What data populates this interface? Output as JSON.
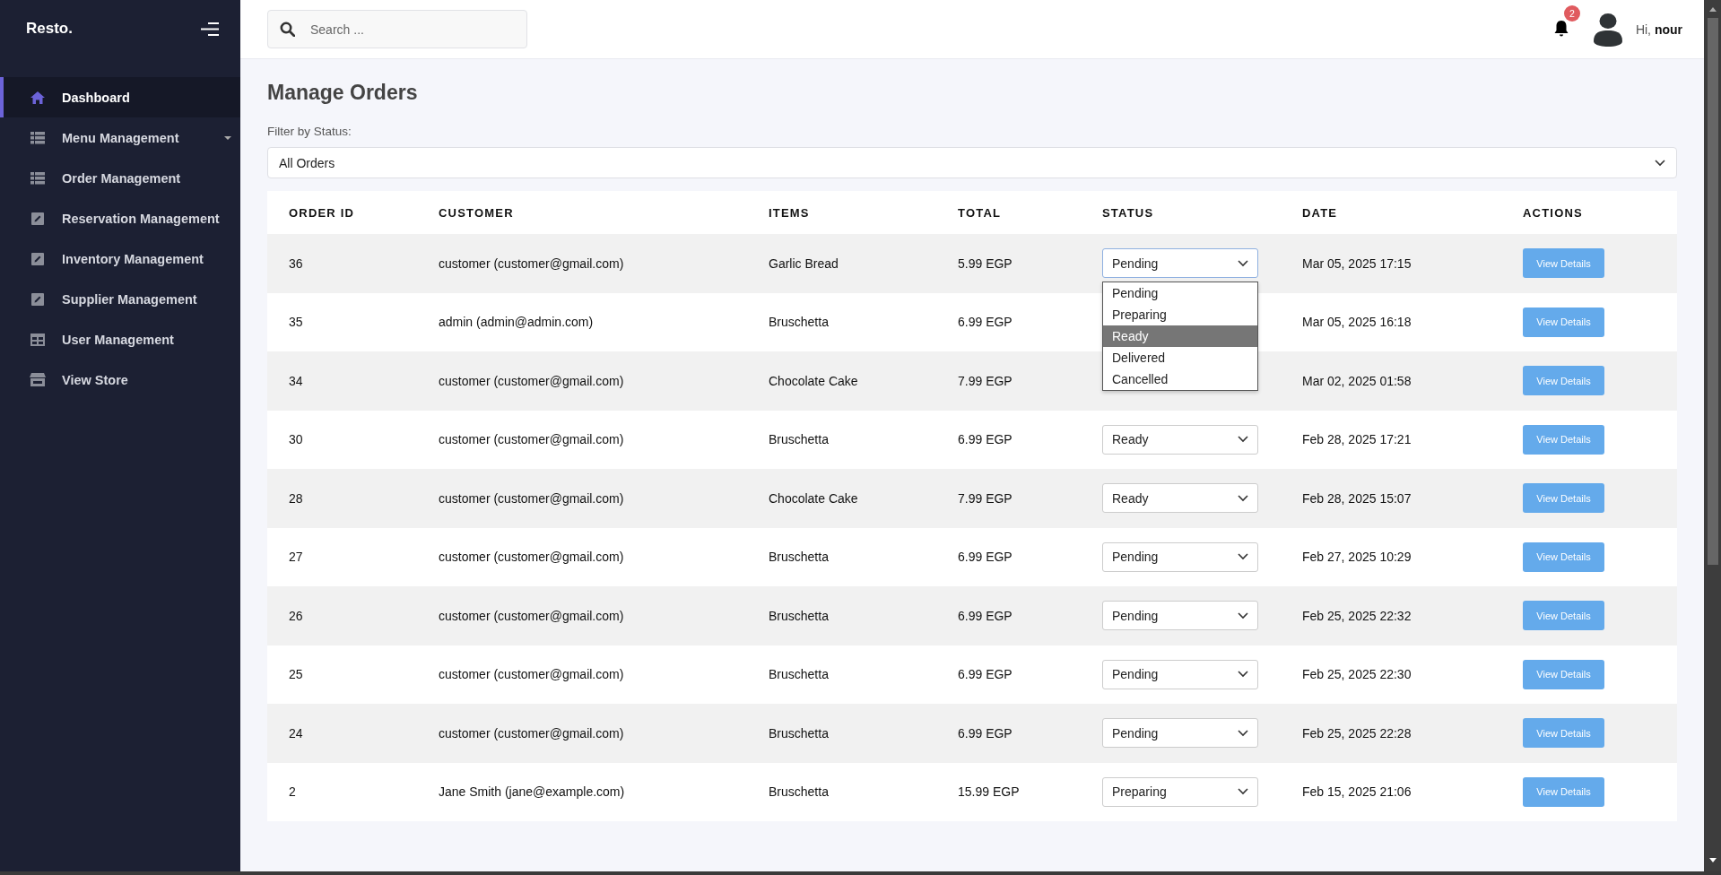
{
  "sidebar": {
    "logo": "Resto.",
    "items": [
      {
        "label": "Dashboard",
        "kind": "home",
        "selected": true,
        "expandable": false
      },
      {
        "label": "Menu Management",
        "kind": "list",
        "selected": false,
        "expandable": true
      },
      {
        "label": "Order Management",
        "kind": "list",
        "selected": false,
        "expandable": false
      },
      {
        "label": "Reservation Management",
        "kind": "edit",
        "selected": false,
        "expandable": false
      },
      {
        "label": "Inventory Management",
        "kind": "edit",
        "selected": false,
        "expandable": false
      },
      {
        "label": "Supplier Management",
        "kind": "edit",
        "selected": false,
        "expandable": false
      },
      {
        "label": "User Management",
        "kind": "grid",
        "selected": false,
        "expandable": false
      },
      {
        "label": "View Store",
        "kind": "store",
        "selected": false,
        "expandable": false
      }
    ]
  },
  "header": {
    "search": {
      "placeholder": "Search ..."
    },
    "notifications": {
      "count": "2"
    },
    "greeting": "Hi, **nour**"
  },
  "page": {
    "title": "Manage Orders",
    "filter": {
      "label": "Filter by Status:",
      "value": "All Orders"
    }
  },
  "table": {
    "columns": [
      "ORDER ID",
      "CUSTOMER",
      "ITEMS",
      "TOTAL",
      "STATUS",
      "DATE",
      "ACTIONS"
    ],
    "rows": [
      {
        "id": "36",
        "customer": "customer (customer@gmail.com)",
        "items": "Garlic Bread",
        "total": "5.99 EGP",
        "status": "Pending",
        "date": "Mar 05, 2025 17:15",
        "action": "View Details",
        "open": true
      },
      {
        "id": "35",
        "customer": "admin (admin@admin.com)",
        "items": "Bruschetta",
        "total": "6.99 EGP",
        "date": "Mar 05, 2025 16:18",
        "action": "View Details",
        "open": false
      },
      {
        "id": "34",
        "customer": "customer (customer@gmail.com)",
        "items": "Chocolate Cake",
        "total": "7.99 EGP",
        "date": "Mar 02, 2025 01:58",
        "action": "View Details",
        "open": false
      },
      {
        "id": "30",
        "customer": "customer (customer@gmail.com)",
        "items": "Bruschetta",
        "total": "6.99 EGP",
        "status": "Ready",
        "date": "Feb 28, 2025 17:21",
        "action": "View Details",
        "open": false
      },
      {
        "id": "28",
        "customer": "customer (customer@gmail.com)",
        "items": "Chocolate Cake",
        "total": "7.99 EGP",
        "status": "Ready",
        "date": "Feb 28, 2025 15:07",
        "action": "View Details",
        "open": false
      },
      {
        "id": "27",
        "customer": "customer (customer@gmail.com)",
        "items": "Bruschetta",
        "total": "6.99 EGP",
        "status": "Pending",
        "date": "Feb 27, 2025 10:29",
        "action": "View Details",
        "open": false
      },
      {
        "id": "26",
        "customer": "customer (customer@gmail.com)",
        "items": "Bruschetta",
        "total": "6.99 EGP",
        "status": "Pending",
        "date": "Feb 25, 2025 22:32",
        "action": "View Details",
        "open": false
      },
      {
        "id": "25",
        "customer": "customer (customer@gmail.com)",
        "items": "Bruschetta",
        "total": "6.99 EGP",
        "status": "Pending",
        "date": "Feb 25, 2025 22:30",
        "action": "View Details",
        "open": false
      },
      {
        "id": "24",
        "customer": "customer (customer@gmail.com)",
        "items": "Bruschetta",
        "total": "6.99 EGP",
        "status": "Pending",
        "date": "Feb 25, 2025 22:28",
        "action": "View Details",
        "open": false
      },
      {
        "id": "2",
        "customer": "Jane Smith (jane@example.com)",
        "items": "Bruschetta",
        "total": "15.99 EGP",
        "status": "Preparing",
        "date": "Feb 15, 2025 21:06",
        "action": "View Details",
        "open": false
      }
    ]
  },
  "status_options": [
    {
      "label": "Pending",
      "selected": false
    },
    {
      "label": "Preparing",
      "selected": false
    },
    {
      "label": "Ready",
      "selected": true
    },
    {
      "label": "Delivered",
      "selected": false
    },
    {
      "label": "Cancelled",
      "selected": false
    }
  ]
}
